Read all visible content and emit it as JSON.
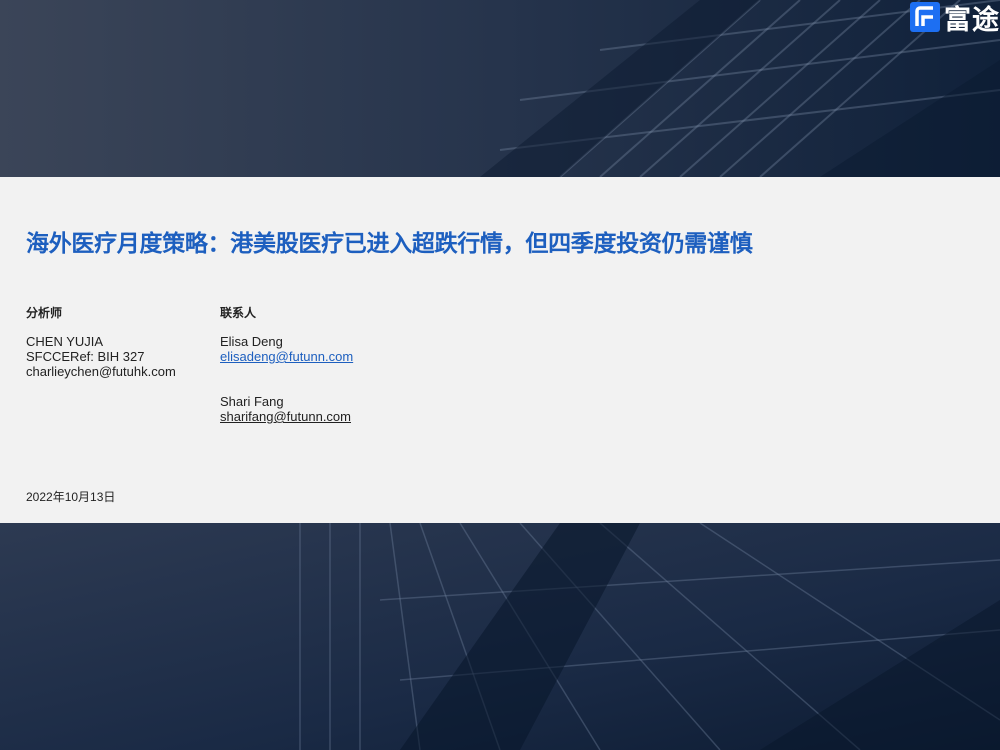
{
  "logo": {
    "text": "富途"
  },
  "report": {
    "title": "海外医疗月度策略：港美股医疗已进入超跌行情，但四季度投资仍需谨慎",
    "date": "2022年10月13日"
  },
  "analyst": {
    "heading": "分析师",
    "name": "CHEN YUJIA",
    "ref": "SFCCERef: BIH 327",
    "email": "charlieychen@futuhk.com"
  },
  "contacts": {
    "heading": "联系人",
    "people": [
      {
        "name": "Elisa Deng",
        "email": "elisadeng@futunn.com"
      },
      {
        "name": "Shari Fang",
        "email": "sharifang@futunn.com"
      }
    ]
  },
  "colors": {
    "accent": "#1d5fbf",
    "logo_blue": "#1d6ff2",
    "panel": "#f2f2f2"
  }
}
